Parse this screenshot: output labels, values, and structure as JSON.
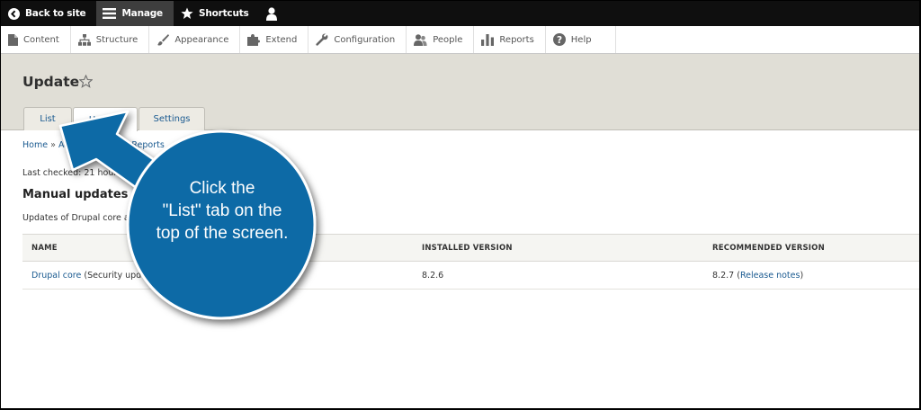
{
  "toolbar": {
    "back_label": "Back to site",
    "manage_label": "Manage",
    "shortcuts_label": "Shortcuts"
  },
  "tray": {
    "items": [
      {
        "label": "Content",
        "icon": "file-icon"
      },
      {
        "label": "Structure",
        "icon": "sitemap-icon"
      },
      {
        "label": "Appearance",
        "icon": "paintbrush-icon"
      },
      {
        "label": "Extend",
        "icon": "puzzle-icon"
      },
      {
        "label": "Configuration",
        "icon": "wrench-icon"
      },
      {
        "label": "People",
        "icon": "people-icon"
      },
      {
        "label": "Reports",
        "icon": "bar-chart-icon"
      },
      {
        "label": "Help",
        "icon": "help-icon"
      }
    ]
  },
  "page": {
    "title": "Update",
    "tabs": [
      "List",
      "Update",
      "Settings"
    ],
    "active_tab": "Update"
  },
  "breadcrumb": {
    "home": "Home",
    "admin": "Administration",
    "reports": "Reports",
    "sep": "»"
  },
  "content": {
    "last_checked": "Last checked: 21 hours",
    "section_title": "Manual updates re",
    "section_desc": "Updates of Drupal core a"
  },
  "table": {
    "headers": [
      "Name",
      "Installed version",
      "Recommended version"
    ],
    "row": {
      "name_link": "Drupal core",
      "name_suffix": "(Security upda",
      "installed": "8.2.6",
      "recommended": "8.2.7",
      "notes_open": "(",
      "notes_link": "Release notes",
      "notes_close": ")"
    }
  },
  "callout": {
    "line1": "Click the",
    "line2": "\"List\" tab on the",
    "line3": "top of the screen.",
    "color": "#0f6aa6"
  },
  "colors": {
    "toolbar_bg": "#0f0f0f",
    "header_bg": "#e0ded6",
    "link": "#1a5a90"
  }
}
